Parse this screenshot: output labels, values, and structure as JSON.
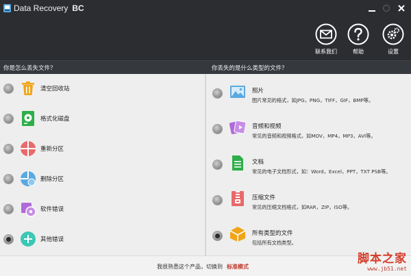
{
  "window": {
    "title": "Data Recovery",
    "title_badge": "BC"
  },
  "header": {
    "buttons": [
      {
        "label": "联系我们",
        "icon": "mail-icon"
      },
      {
        "label": "帮助",
        "icon": "help-icon"
      },
      {
        "label": "设置",
        "icon": "gear-icon"
      }
    ]
  },
  "left_panel": {
    "title": "你是怎么丢失文件？",
    "options": [
      {
        "label": "清空回收站",
        "icon": "trash-icon",
        "color": "#f0a418",
        "selected": false
      },
      {
        "label": "格式化磁盘",
        "icon": "disk-icon",
        "color": "#2fae4a",
        "selected": false
      },
      {
        "label": "重新分区",
        "icon": "partition-icon",
        "color": "#e86a6a",
        "selected": false
      },
      {
        "label": "删除分区",
        "icon": "delete-partition-icon",
        "color": "#5aa9e0",
        "selected": false
      },
      {
        "label": "软件错误",
        "icon": "software-error-icon",
        "color": "#b06ad8",
        "selected": false
      },
      {
        "label": "其他错误",
        "icon": "other-error-icon",
        "color": "#3cc7b6",
        "selected": true
      }
    ]
  },
  "right_panel": {
    "title": "你丢失的是什么类型的文件？",
    "options": [
      {
        "title": "照片",
        "desc": "图片常见的格式，如JPG，PNG，TIFF，GIF，BMP等。",
        "icon": "photo-icon",
        "color": "#5aa9e0",
        "selected": false
      },
      {
        "title": "音频和视频",
        "desc": "常见的音频和视频格式，如MOV，MP4，MP3，AVI等。",
        "icon": "media-icon",
        "color": "#b06ad8",
        "selected": false
      },
      {
        "title": "文档",
        "desc": "常见的电子文档形式，如：Word，Excel，PPT，TXT PSB等。",
        "icon": "document-icon",
        "color": "#2fae4a",
        "selected": false
      },
      {
        "title": "压缩文件",
        "desc": "常见的压缩文档格式，如RAR，ZIP，ISO等。",
        "icon": "archive-icon",
        "color": "#e86a6a",
        "selected": false
      },
      {
        "title": "所有类型的文件",
        "desc": "包括所有文档类型。",
        "icon": "all-files-icon",
        "color": "#f0a418",
        "selected": true
      }
    ]
  },
  "footer": {
    "text": "我很熟悉这个产品，切换到",
    "link": "标准模式"
  },
  "watermark": {
    "main": "脚本之家",
    "sub": "www.jb51.net"
  }
}
